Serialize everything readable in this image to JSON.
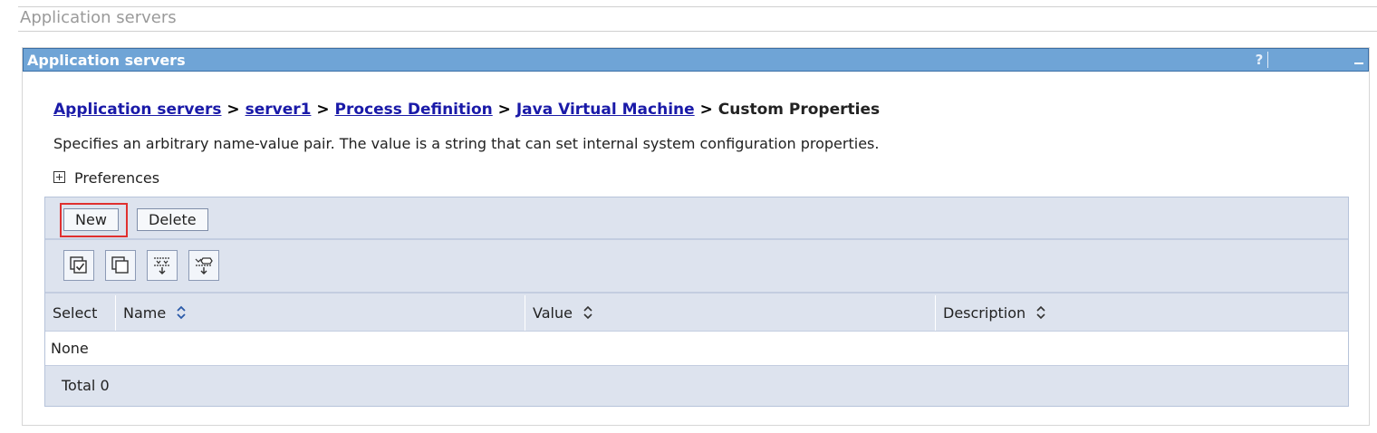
{
  "page": {
    "title": "Application servers"
  },
  "portlet": {
    "title": "Application servers",
    "help_label": "?"
  },
  "breadcrumb": {
    "links": [
      "Application servers",
      "server1",
      "Process Definition",
      "Java Virtual Machine"
    ],
    "separator": ">",
    "current": "Custom Properties"
  },
  "description": "Specifies an arbitrary name-value pair. The value is a string that can set internal system configuration properties.",
  "preferences": {
    "label": "Preferences"
  },
  "toolbar": {
    "new_label": "New",
    "delete_label": "Delete"
  },
  "icons": [
    "select-all-icon",
    "deselect-all-icon",
    "show-filter-icon",
    "clear-filter-icon"
  ],
  "table": {
    "columns": [
      "Select",
      "Name",
      "Value",
      "Description"
    ],
    "empty_text": "None",
    "total_label": "Total 0"
  },
  "colors": {
    "titlebar_bg": "#6fa4d6",
    "grid_bg": "#dde3ee",
    "link": "#1a1aa8",
    "highlight": "#e03030"
  }
}
